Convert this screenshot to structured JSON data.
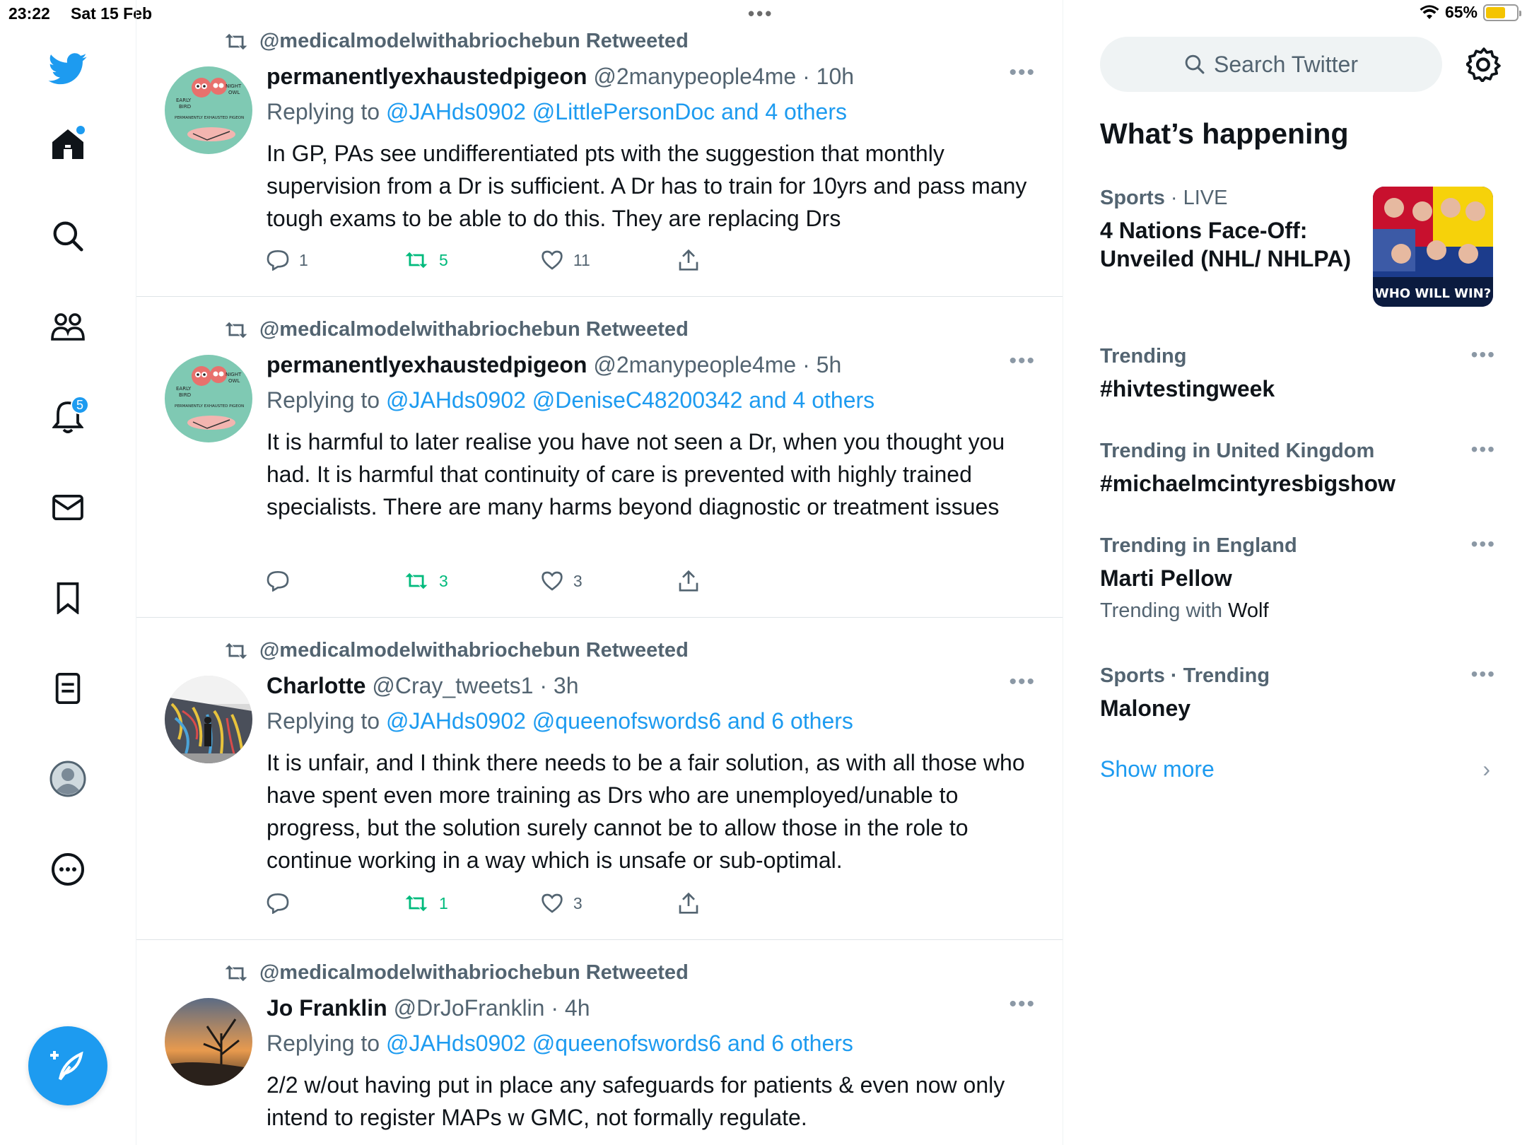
{
  "status_bar": {
    "time": "23:22",
    "date": "Sat 15 Feb",
    "battery": "65%",
    "battery_level": 0.65
  },
  "nav": {
    "notifications_count": "5"
  },
  "tweets": [
    {
      "retweeted_by": "@medicalmodelwithabriochebun Retweeted",
      "name": "permanentlyexhaustedpigeon",
      "handle": "@2manypeople4me · 10h",
      "replying_prefix": "Replying to",
      "replying_to": "@JAHds0902 @LittlePersonDoc and 4 others",
      "text": "In GP, PAs see undifferentiated pts with the suggestion that monthly supervision from a Dr is sufficient. A Dr has to train for 10yrs and pass many tough exams to be able to do this. They are replacing Drs",
      "replies": "1",
      "retweets": "5",
      "likes": "11"
    },
    {
      "retweeted_by": "@medicalmodelwithabriochebun Retweeted",
      "name": "permanentlyexhaustedpigeon",
      "handle": "@2manypeople4me · 5h",
      "replying_prefix": "Replying to",
      "replying_to": "@JAHds0902 @DeniseC48200342 and 4 others",
      "text": "It is harmful to later realise you have not seen a Dr, when you thought you had. It is harmful that continuity of care is prevented with highly trained specialists. There are many harms beyond diagnostic or treatment issues",
      "replies": "",
      "retweets": "3",
      "likes": "3"
    },
    {
      "retweeted_by": "@medicalmodelwithabriochebun Retweeted",
      "name": "Charlotte",
      "handle": "@Cray_tweets1 · 3h",
      "replying_prefix": "Replying to",
      "replying_to": "@JAHds0902 @queenofswords6 and 6 others",
      "text": "It is unfair, and I think there needs to be a fair solution, as with all those who have spent even more training as Drs who are unemployed/unable to progress, but the solution surely cannot be to allow those in the role to continue working in a way which is unsafe or sub-optimal.",
      "replies": "",
      "retweets": "1",
      "likes": "3"
    },
    {
      "retweeted_by": "@medicalmodelwithabriochebun Retweeted",
      "name": "Jo Franklin",
      "handle": "@DrJoFranklin · 4h",
      "replying_prefix": "Replying to",
      "replying_to": "@JAHds0902 @queenofswords6 and 6 others",
      "text": "2/2 w/out having put in place any safeguards for patients & even now only intend to register MAPs w GMC, not formally regulate."
    }
  ],
  "avatar_text": {
    "night": "NIGHT",
    "owl": "OWL",
    "early": "EARLY",
    "bird": "BIRD",
    "caption": "PERMANENTLY EXHAUSTED PIGEON"
  },
  "sidebar": {
    "search_placeholder": "Search Twitter",
    "whats_happening": "What’s happening",
    "trends": [
      {
        "category": "Sports",
        "sep": " · ",
        "status": "LIVE",
        "title": "4 Nations Face-Off: Unveiled (NHL/ NHLPA)",
        "image_caption": "WHO WILL WIN?"
      },
      {
        "meta": "Trending",
        "title": "#hivtestingweek"
      },
      {
        "meta": "Trending in United Kingdom",
        "title": "#michaelmcintyresbigshow"
      },
      {
        "meta": "Trending in England",
        "title": "Marti Pellow",
        "sub_prefix": "Trending with",
        "sub_value": "Wolf"
      },
      {
        "meta": "Sports · Trending",
        "title": "Maloney"
      }
    ],
    "show_more": "Show more"
  },
  "colors": {
    "accent": "#1d9bf0",
    "retweet_green": "#00ba7c",
    "secondary_text": "#536471"
  }
}
